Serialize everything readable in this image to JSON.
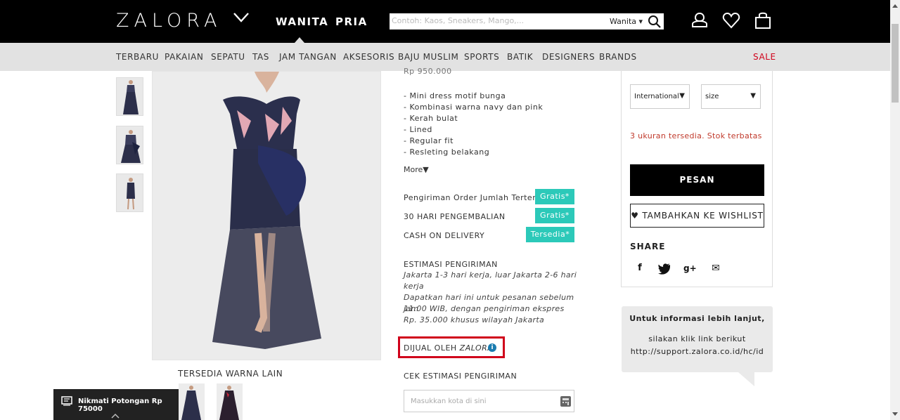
{
  "header": {
    "logo": "ZALORA",
    "gender_tabs": [
      {
        "label": "WANITA"
      },
      {
        "label": "PRIA"
      }
    ],
    "search": {
      "placeholder": "Contoh: Kaos, Sneakers, Mango,...",
      "scope": "Wanita ▾"
    },
    "icons": [
      "user-icon",
      "heart-icon",
      "bag-icon"
    ]
  },
  "categories": [
    "TERBARU",
    "PAKAIAN",
    "SEPATU",
    "TAS",
    "JAM TANGAN",
    "AKSESORIS",
    "BAJU MUSLIM",
    "SPORTS",
    "BATIK",
    "DESIGNERS",
    "BRANDS"
  ],
  "sale_label": "SALE",
  "product": {
    "price_partial": "Rp 950.000",
    "description": [
      "- Mini dress motif bunga",
      "- Kombinasi warna navy dan pink",
      "- Kerah bulat",
      "- Lined",
      "- Regular fit",
      "- Resleting belakang"
    ],
    "more_label": "More▼",
    "services": [
      {
        "label": "Pengiriman Order Jumlah Tertentu",
        "badge": "Gratis*"
      },
      {
        "label": "30 HARI PENGEMBALIAN",
        "badge": "Gratis*"
      },
      {
        "label": "CASH ON DELIVERY",
        "badge": "Tersedia*"
      }
    ],
    "estimate_title": "ESTIMASI PENGIRIMAN",
    "estimate_lines": [
      "Jakarta 1-3 hari kerja, luar Jakarta 2-6 hari",
      "kerja",
      "Dapatkan hari ini untuk pesanan sebelum jam",
      "11.00 WIB, dengan pengiriman ekspres",
      "Rp. 35.000 khusus wilayah Jakarta"
    ],
    "seller_prefix": "DIJUAL OLEH",
    "seller_name": "ZALORA",
    "info_glyph": "i",
    "cek_title": "CEK ESTIMASI PENGIRIMAN",
    "city_placeholder": "Masukkan kota di sini",
    "colors_title": "TERSEDIA WARNA LAIN"
  },
  "buy_panel": {
    "size_system": "International",
    "size_value": "size",
    "stock_text": "3 ukuran tersedia. Stok terbatas",
    "order_label": "PESAN",
    "wishlist_label": "♥ TAMBAHKAN KE WISHLIST",
    "share_label": "SHARE",
    "social": [
      {
        "icon": "facebook-icon",
        "glyph": "f"
      },
      {
        "icon": "twitter-icon",
        "glyph": "🐦"
      },
      {
        "icon": "google-plus-icon",
        "glyph": "g+"
      },
      {
        "icon": "email-icon",
        "glyph": "✉"
      }
    ]
  },
  "info_box": {
    "title": "Untuk informasi lebih lanjut,",
    "line1": "silakan klik link berikut",
    "link": "http://support.zalora.co.id/hc/id"
  },
  "promo": {
    "text": "Nikmati Potongan Rp 75000"
  },
  "colors": {
    "accent": "#2cc9b9",
    "highlight": "#d0021b",
    "topbar": "#000000"
  }
}
